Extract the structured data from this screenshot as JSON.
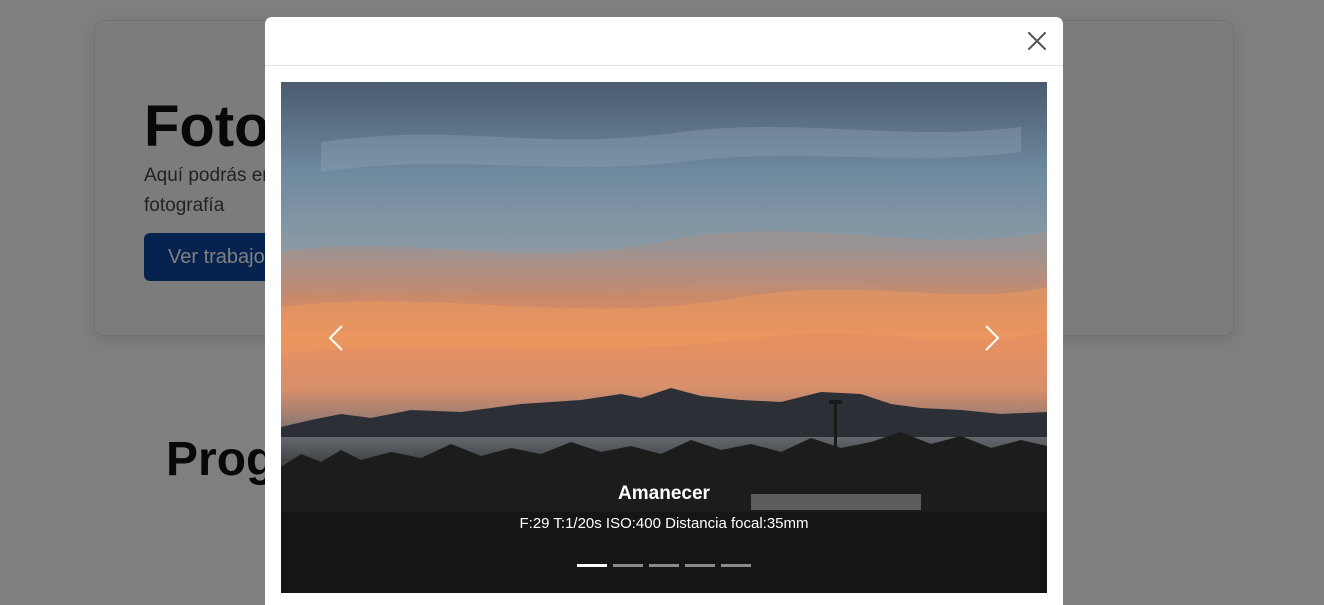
{
  "page": {
    "hero": {
      "title": "Fotografía",
      "text": "Aquí podrás encontrar algunos de mis trabajos relacionados a la fotografía",
      "button_label": "Ver trabajos"
    },
    "section_title": "Programación"
  },
  "modal": {
    "close_icon": "close-icon",
    "carousel": {
      "slide": {
        "title": "Amanecer",
        "text": "F:29 T:1/20s ISO:400 Distancia focal:35mm"
      },
      "prev_icon": "chevron-left-icon",
      "next_icon": "chevron-right-icon",
      "indicator_count": 5,
      "active_index": 0
    }
  }
}
